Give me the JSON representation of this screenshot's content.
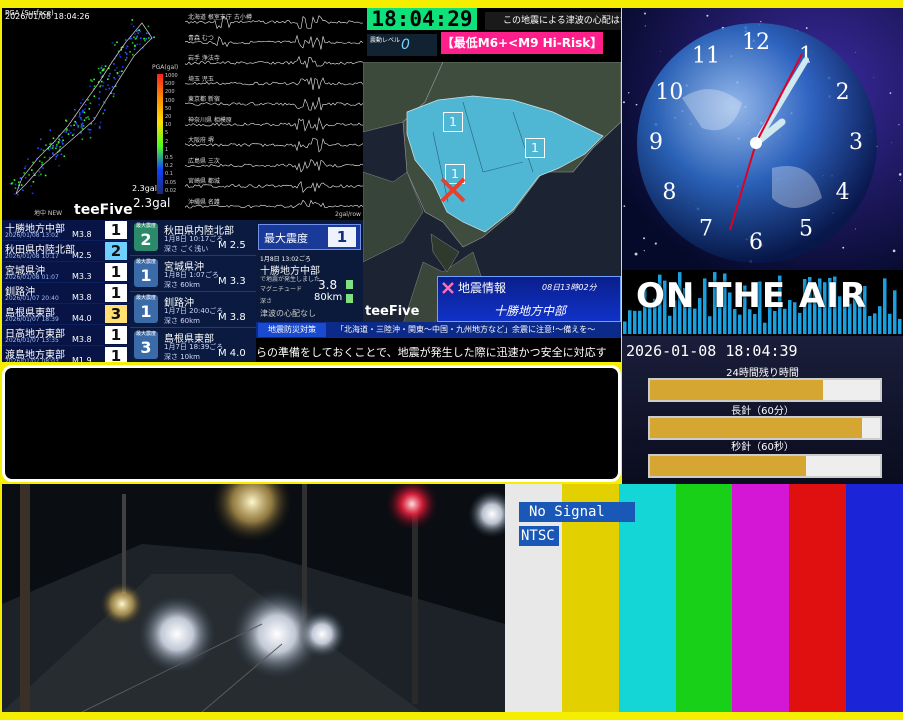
{
  "pga": {
    "header": "PGA (Surface)",
    "timestamp": "2026/01/08 18:04:26",
    "scale_title": "PGA(gal)",
    "scale_ticks": [
      "1000",
      "500",
      "200",
      "100",
      "50",
      "20",
      "10",
      "5",
      "2",
      "1",
      "0.5",
      "0.2",
      "0.1",
      "0.05",
      "0.02"
    ],
    "max_small": "2.3gal",
    "max_large": "2.3gal",
    "footer_left": "地中 NEW",
    "brand": "teeFive"
  },
  "waveforms": {
    "stations": [
      "北海道 根室支庁 古小樽",
      "青森 むつ",
      "岩手 浄法寺",
      "埼玉 児玉",
      "東京都 新宿",
      "神奈川県 相模原",
      "大阪府 堺",
      "広島県 三次",
      "宮崎県 都城",
      "沖縄県 名護"
    ],
    "scale": "2gal/row"
  },
  "map": {
    "clock": "18:04:29",
    "tsunami_note": "この地震による津波の心配はなし",
    "level_label": "震動レベル",
    "level_value": "0",
    "risk_banner": "【最低M6+<M9 Hi-Risk】",
    "intensity_markers": [
      "1",
      "1",
      "1"
    ],
    "brand": "teeFive",
    "info_title": "地震情報",
    "info_time": "08日13時02分",
    "info_region": "十勝地方中部"
  },
  "eq_list": [
    {
      "name": "十勝地方中部",
      "date": "2026/01/08 13:02",
      "mag": "M3.8",
      "int": "1",
      "color": "#ffffff"
    },
    {
      "name": "秋田県内陸北部",
      "date": "2026/01/08 10:17",
      "mag": "M2.5",
      "int": "2",
      "color": "#6fd0ff"
    },
    {
      "name": "宮城県沖",
      "date": "2026/01/08 01:07",
      "mag": "M3.3",
      "int": "1",
      "color": "#ffffff"
    },
    {
      "name": "釧路沖",
      "date": "2026/01/07 20:40",
      "mag": "M3.8",
      "int": "1",
      "color": "#ffffff"
    },
    {
      "name": "島根県東部",
      "date": "2026/01/07 18:39",
      "mag": "M4.0",
      "int": "3",
      "color": "#ffe070"
    },
    {
      "name": "日高地方東部",
      "date": "2026/01/07 13:35",
      "mag": "M3.8",
      "int": "1",
      "color": "#ffffff"
    },
    {
      "name": "渡島地方東部",
      "date": "2026/01/07 08:03",
      "mag": "M1.9",
      "int": "1",
      "color": "#ffffff"
    }
  ],
  "eq_cards": [
    {
      "label": "最大震度",
      "int": "2",
      "name": "秋田県内陸北部",
      "date": "1月8日 10:17ごろ",
      "depth": "深さ ごく浅い",
      "mag": "M 2.5",
      "color": "#2a8a6a"
    },
    {
      "label": "最大震度",
      "int": "1",
      "name": "宮城県沖",
      "date": "1月8日 1:07ごろ",
      "depth": "深さ 60km",
      "mag": "M 3.3",
      "color": "#3a6aa8"
    },
    {
      "label": "最大震度",
      "int": "1",
      "name": "釧路沖",
      "date": "1月7日 20:40ごろ",
      "depth": "深さ 60km",
      "mag": "M 3.8",
      "color": "#3a6aa8"
    },
    {
      "label": "最大震度",
      "int": "3",
      "name": "島根県東部",
      "date": "1月7日 18:39ごろ",
      "depth": "深さ 10km",
      "mag": "M 4.0",
      "color": "#3a6aa8"
    }
  ],
  "max_intensity": {
    "label": "最大震度",
    "value": "1",
    "date": "1月8日 13:02ごろ",
    "region": "十勝地方中部",
    "sub": "で地震が発生しました",
    "mag_label": "マグニチュード",
    "mag_value": "3.8",
    "depth_label": "深さ",
    "depth_value": "80km",
    "tsunami": "津波の心配なし"
  },
  "alert": {
    "tag": "地震防災対策",
    "headline": "「北海道・三陸沖・関東〜中国・九州地方など」余震に注意!〜備えを〜",
    "ticker": "らの準備をしておくことで、地震が発生した際に迅速かつ安全に対応す"
  },
  "clock": {
    "numerals": [
      "12",
      "1",
      "2",
      "3",
      "4",
      "5",
      "6",
      "7",
      "8",
      "9",
      "10",
      "11"
    ]
  },
  "on_air": {
    "title": "ON THE AIR",
    "datetime": "2026-01-08 18:04:39",
    "bars": [
      {
        "label": "24時間残り時間",
        "fill": 0.75
      },
      {
        "label": "長針（60分）",
        "fill": 0.92
      },
      {
        "label": "秒針（60秒）",
        "fill": 0.68
      }
    ]
  },
  "test_pattern": {
    "status": "No Signal",
    "format": "NTSC",
    "colors": [
      "#e8e8e8",
      "#e3d000",
      "#14d6d6",
      "#18d018",
      "#d417d4",
      "#e01010",
      "#1c24d8"
    ]
  }
}
